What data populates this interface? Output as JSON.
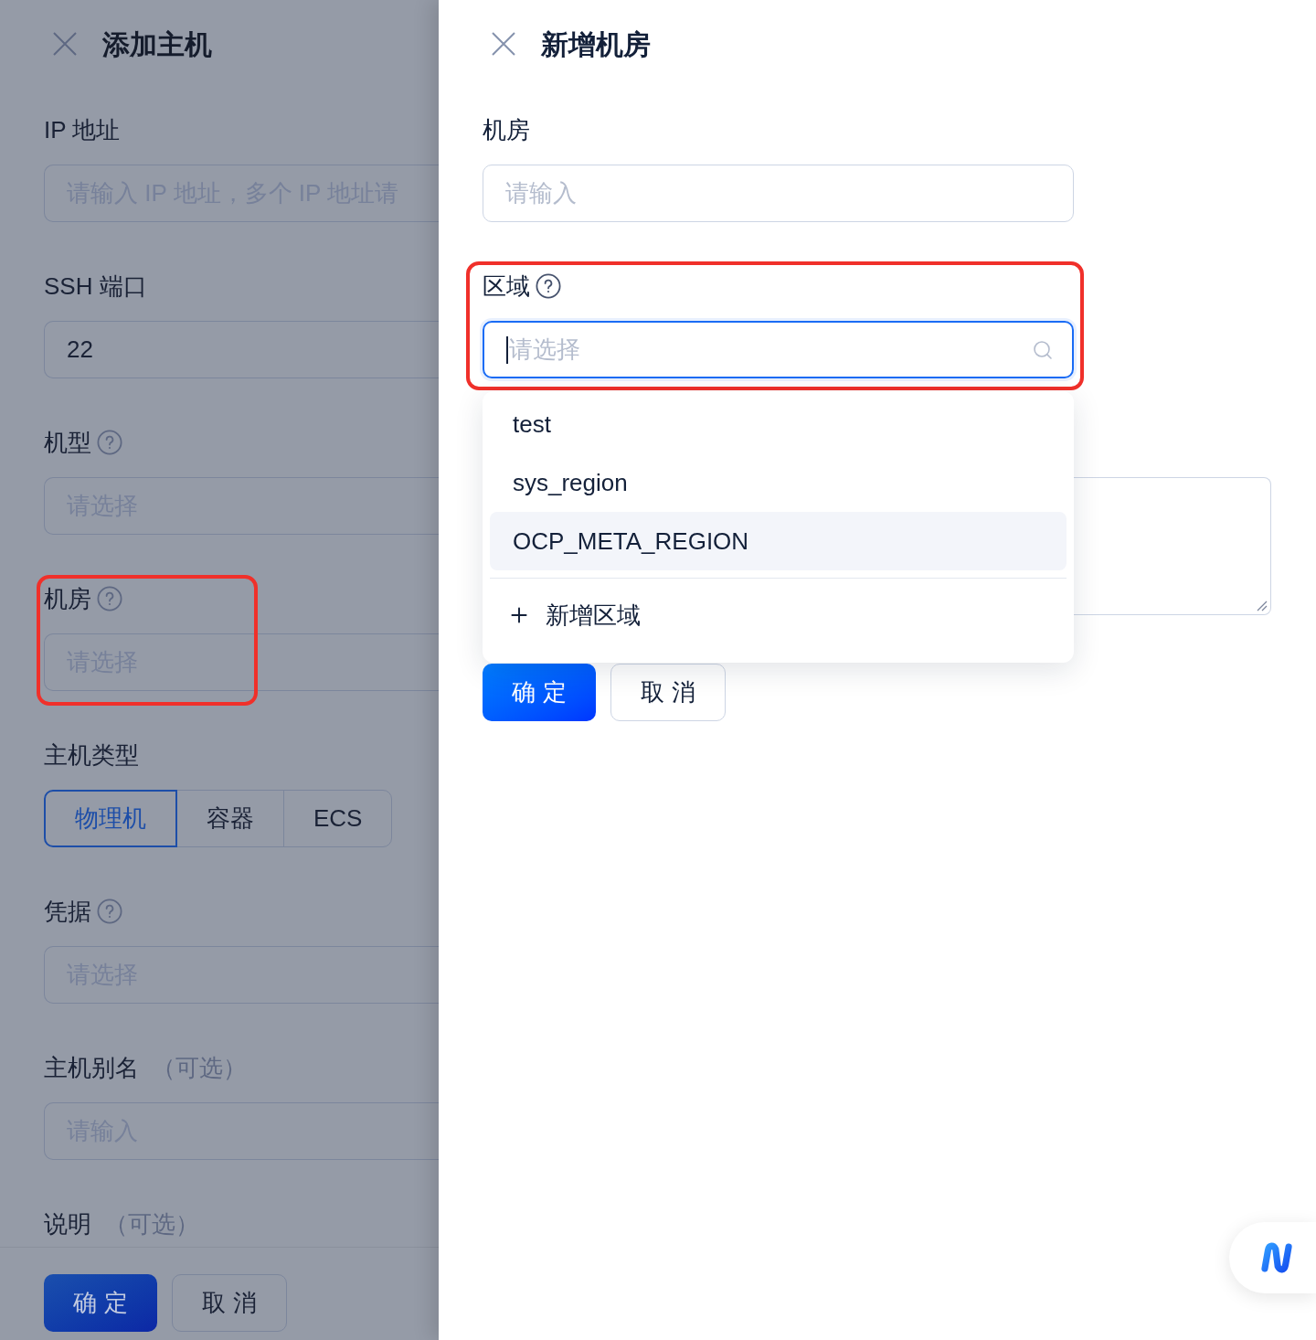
{
  "host_drawer": {
    "title": "添加主机",
    "fields": [
      {
        "kind": "input",
        "label": "IP 地址",
        "focused": false,
        "placeholder": "请输入 IP 地址，多个 IP 地址请"
      },
      {
        "kind": "input",
        "label": "SSH 端口",
        "focused": false,
        "value": "22"
      },
      {
        "kind": "select",
        "label": "机型",
        "help": true,
        "focused": false,
        "placeholder": "请选择"
      },
      {
        "kind": "select",
        "label": "机房",
        "help": true,
        "annotated": true,
        "focused": false,
        "placeholder": "请选择"
      },
      {
        "kind": "segmented",
        "label": "主机类型",
        "options": [
          {
            "label": "物理机",
            "selected": true
          },
          {
            "label": "容器",
            "selected": false
          },
          {
            "label": "ECS",
            "selected": false
          }
        ]
      },
      {
        "kind": "select",
        "label": "凭据",
        "help": true,
        "focused": false,
        "placeholder": "请选择"
      },
      {
        "kind": "input",
        "label": "主机别名",
        "optional": "（可选）",
        "focused": false,
        "placeholder": "请输入"
      },
      {
        "kind": "label",
        "label": "说明",
        "optional": "（可选）"
      }
    ],
    "buttons": [
      {
        "kind": "primary",
        "label": "确 定"
      },
      {
        "kind": "default",
        "label": "取 消"
      }
    ]
  },
  "room_drawer": {
    "title": "新增机房",
    "fields": [
      {
        "kind": "input",
        "label": "机房",
        "focused": false,
        "placeholder": "请输入"
      },
      {
        "kind": "search_select",
        "label": "区域",
        "help": true,
        "annotated": true,
        "focused": true,
        "placeholder": "请选择"
      },
      {
        "kind": "textarea",
        "focused": false
      }
    ],
    "dropdown": {
      "options": [
        {
          "label": "test",
          "selected": false
        },
        {
          "label": "sys_region",
          "selected": false
        },
        {
          "label": "OCP_META_REGION",
          "selected": true
        }
      ],
      "add_action": "新增区域"
    },
    "buttons": [
      {
        "kind": "primary",
        "label": "确 定"
      },
      {
        "kind": "default",
        "label": "取 消"
      }
    ]
  }
}
